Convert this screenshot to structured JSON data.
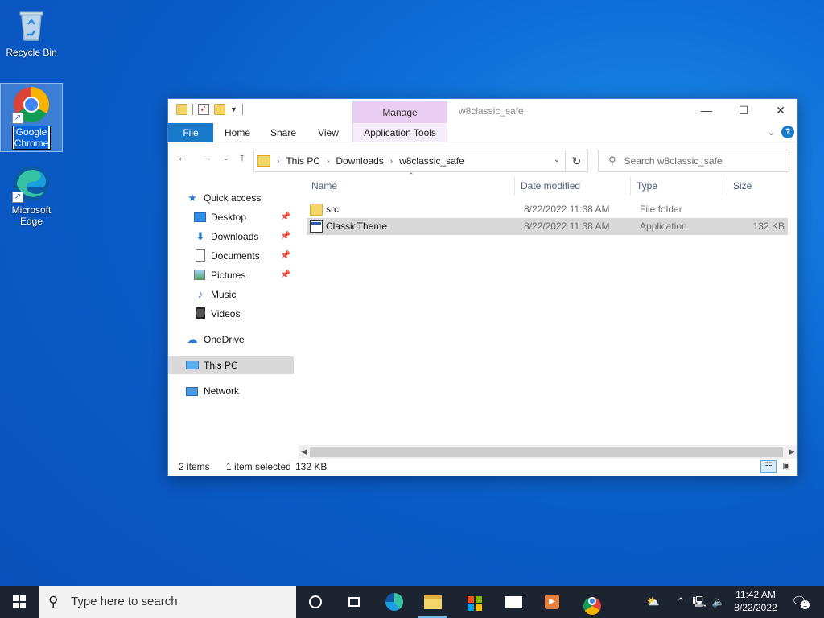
{
  "desktop": {
    "icons": [
      {
        "label": "Recycle Bin"
      },
      {
        "label_line1": "Google",
        "label_line2": "Chrome"
      },
      {
        "label_line1": "Microsoft",
        "label_line2": "Edge"
      }
    ]
  },
  "window": {
    "title": "w8classic_safe",
    "contextual_tab": "Manage",
    "controls": {
      "minimize": "—",
      "maximize": "☐",
      "close": "✕"
    },
    "ribbon_tabs": [
      "File",
      "Home",
      "Share",
      "View",
      "Application Tools"
    ],
    "breadcrumb": [
      "This PC",
      "Downloads",
      "w8classic_safe"
    ],
    "search_placeholder": "Search w8classic_safe",
    "nav_pane": {
      "quick_access": "Quick access",
      "pinned": [
        "Desktop",
        "Downloads",
        "Documents",
        "Pictures"
      ],
      "others": [
        "Music",
        "Videos"
      ],
      "onedrive": "OneDrive",
      "this_pc": "This PC",
      "network": "Network"
    },
    "columns": [
      "Name",
      "Date modified",
      "Type",
      "Size"
    ],
    "files": [
      {
        "name": "src",
        "date": "8/22/2022 11:38 AM",
        "type": "File folder",
        "size": "",
        "kind": "folder"
      },
      {
        "name": "ClassicTheme",
        "date": "8/22/2022 11:38 AM",
        "type": "Application",
        "size": "132 KB",
        "kind": "app"
      }
    ],
    "status": {
      "count": "2 items",
      "selected": "1 item selected",
      "size": "132 KB"
    }
  },
  "taskbar": {
    "search_placeholder": "Type here to search",
    "clock_time": "11:42 AM",
    "clock_date": "8/22/2022",
    "notification_count": "1"
  }
}
